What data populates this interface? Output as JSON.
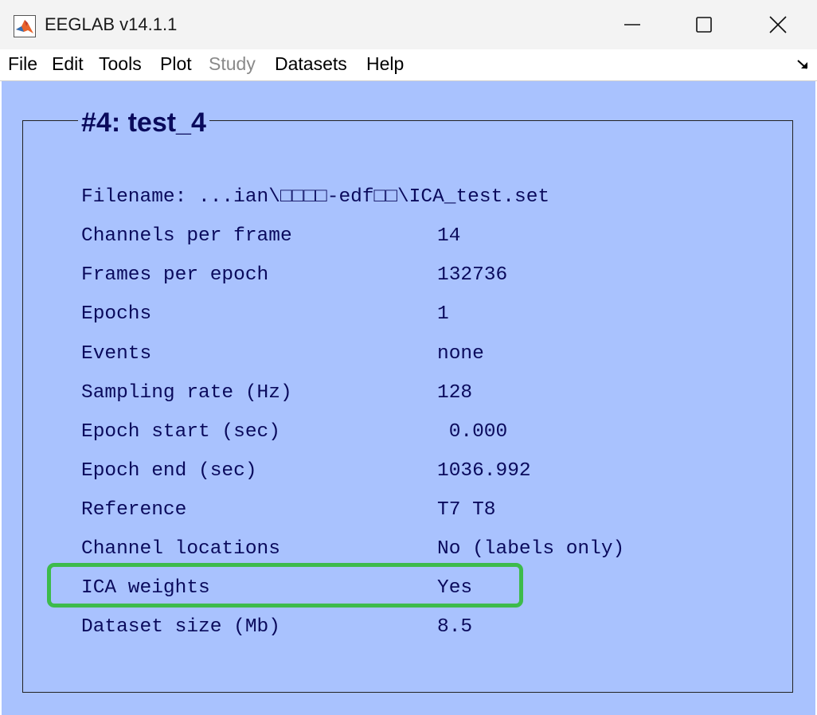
{
  "window": {
    "title": "EEGLAB v14.1.1",
    "icon": "matlab-icon",
    "controls": [
      "minimize-icon",
      "maximize-icon",
      "close-icon"
    ]
  },
  "menu": {
    "file": "File",
    "edit": "Edit",
    "tools": "Tools",
    "plot": "Plot",
    "study": "Study",
    "datasets": "Datasets",
    "help": "Help",
    "dock_icon": "dock-arrow-icon"
  },
  "dataset": {
    "title": "#4: test_4",
    "filename": "Filename: ...ian\\□□□□-edf□□\\ICA_test.set",
    "rows": [
      {
        "label": "Channels per frame",
        "value": "14"
      },
      {
        "label": "Frames per epoch",
        "value": "132736"
      },
      {
        "label": "Epochs",
        "value": "1"
      },
      {
        "label": "Events",
        "value": "none"
      },
      {
        "label": "Sampling rate (Hz)",
        "value": "128"
      },
      {
        "label": "Epoch start (sec)",
        "value": " 0.000"
      },
      {
        "label": "Epoch end (sec)",
        "value": "1036.992"
      },
      {
        "label": "Reference",
        "value": "T7 T8"
      },
      {
        "label": "Channel locations",
        "value": "No (labels only)"
      },
      {
        "label": "ICA weights",
        "value": "Yes"
      },
      {
        "label": "Dataset size (Mb)",
        "value": "8.5"
      }
    ]
  },
  "colors": {
    "background": "#a9c2fe",
    "text": "#0a0a5c",
    "highlight": "#3dbb4b",
    "disabled_menu": "#8a8a8a"
  }
}
